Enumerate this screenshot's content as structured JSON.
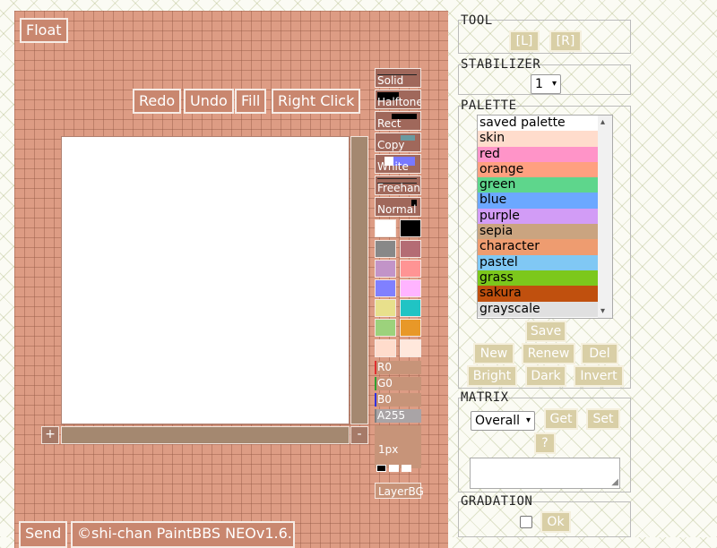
{
  "paint": {
    "float_label": "Float",
    "buttons": {
      "redo": "Redo",
      "undo": "Undo",
      "fill": "Fill",
      "right_click": "Right Click"
    },
    "tools": [
      {
        "label": "Solid"
      },
      {
        "label": "Halftone"
      },
      {
        "label": "Rect"
      },
      {
        "label": "Copy"
      },
      {
        "label": "White"
      },
      {
        "label": "Freehan"
      },
      {
        "label": "Normal"
      }
    ],
    "swatches": [
      [
        "#ffffff",
        "#000000"
      ],
      [
        "#888888",
        "#b46c74"
      ],
      [
        "#c294c8",
        "#ff9494"
      ],
      [
        "#8080ff",
        "#ffb4ff"
      ],
      [
        "#e8e08c",
        "#20c4c4"
      ],
      [
        "#9cd27c",
        "#e89828"
      ],
      [
        "#ffdccc",
        "#ffe8dc"
      ]
    ],
    "rgba": [
      {
        "label": "R0",
        "color": "#e03030"
      },
      {
        "label": "G0",
        "color": "#30a030"
      },
      {
        "label": "B0",
        "color": "#3030e0"
      },
      {
        "label": "A255",
        "color": "#808080"
      }
    ],
    "zoom_in": "+",
    "zoom_out": "-",
    "pen_size": "1px",
    "layer_bg": "LayerBG",
    "send_label": "Send",
    "credit": "©shi-chan PaintBBS NEOv1.6.58"
  },
  "panel": {
    "tool": {
      "title": "TOOL",
      "left": "[L]",
      "right": "[R]"
    },
    "stabilizer": {
      "title": "STABILIZER",
      "value": "1"
    },
    "palette": {
      "title": "PALETTE",
      "items": [
        {
          "name": "saved palette",
          "color": "#ffffff"
        },
        {
          "name": "skin",
          "color": "#ffdccc"
        },
        {
          "name": "red",
          "color": "#ff94c8"
        },
        {
          "name": "orange",
          "color": "#ffa080"
        },
        {
          "name": "green",
          "color": "#5ed68c"
        },
        {
          "name": "blue",
          "color": "#6ca8ff"
        },
        {
          "name": "purple",
          "color": "#d29cf6"
        },
        {
          "name": "sepia",
          "color": "#caa480"
        },
        {
          "name": "character",
          "color": "#ee9c70"
        },
        {
          "name": "pastel",
          "color": "#80c8f4"
        },
        {
          "name": "grass",
          "color": "#7cc81c"
        },
        {
          "name": "sakura",
          "color": "#c0500e"
        },
        {
          "name": "grayscale",
          "color": "#e0e0e0"
        }
      ],
      "save": "Save",
      "new": "New",
      "renew": "Renew",
      "del": "Del",
      "bright": "Bright",
      "dark": "Dark",
      "invert": "Invert"
    },
    "matrix": {
      "title": "MATRIX",
      "select": "Overall",
      "get": "Get",
      "set": "Set",
      "help": "?"
    },
    "gradation": {
      "title": "GRADATION",
      "ok": "Ok"
    }
  }
}
